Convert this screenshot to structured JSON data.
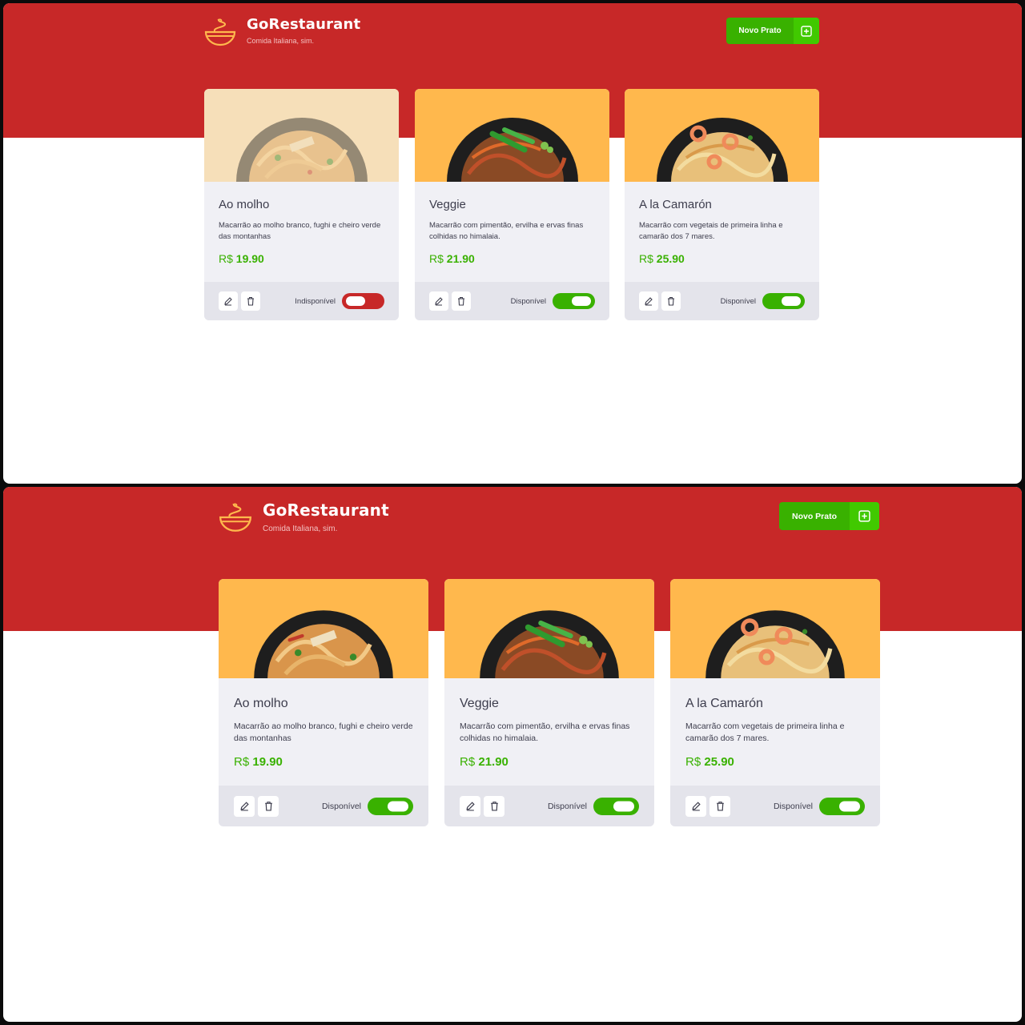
{
  "colors": {
    "hero_red": "#c72828",
    "accent_green": "#39b100",
    "card_image_bg": "#ffb84d",
    "card_bg": "#f0f0f5",
    "footer_bg": "#e4e4eb"
  },
  "screens": [
    {
      "header": {
        "logo_icon": "bowl-icon",
        "title": "GoRestaurant",
        "subtitle": "Comida Italiana, sim.",
        "new_button_label": "Novo Prato",
        "new_button_icon": "plus-square-icon"
      },
      "cards": [
        {
          "name": "Ao molho",
          "description": "Macarrão ao molho branco, fughi e cheiro verde das montanhas",
          "currency": "R$",
          "price": "19.90",
          "availability_label": "Indisponível",
          "available": false,
          "image_icon": "pasta-plate-image"
        },
        {
          "name": "Veggie",
          "description": "Macarrão com pimentão, ervilha e ervas finas colhidas no himalaia.",
          "currency": "R$",
          "price": "21.90",
          "availability_label": "Disponível",
          "available": true,
          "image_icon": "noodles-veggie-image"
        },
        {
          "name": "A la Camarón",
          "description": "Macarrão com vegetais de primeira linha e camarão dos 7 mares.",
          "currency": "R$",
          "price": "25.90",
          "availability_label": "Disponível",
          "available": true,
          "image_icon": "shrimp-pasta-image"
        }
      ]
    },
    {
      "header": {
        "logo_icon": "bowl-icon",
        "title": "GoRestaurant",
        "subtitle": "Comida Italiana, sim.",
        "new_button_label": "Novo Prato",
        "new_button_icon": "plus-square-icon"
      },
      "cards": [
        {
          "name": "Ao molho",
          "description": "Macarrão ao molho branco, fughi e cheiro verde das montanhas",
          "currency": "R$",
          "price": "19.90",
          "availability_label": "Disponível",
          "available": true,
          "image_icon": "pasta-plate-image"
        },
        {
          "name": "Veggie",
          "description": "Macarrão com pimentão, ervilha e ervas finas colhidas no himalaia.",
          "currency": "R$",
          "price": "21.90",
          "availability_label": "Disponível",
          "available": true,
          "image_icon": "noodles-veggie-image"
        },
        {
          "name": "A la Camarón",
          "description": "Macarrão com vegetais de primeira linha e camarão dos 7 mares.",
          "currency": "R$",
          "price": "25.90",
          "availability_label": "Disponível",
          "available": true,
          "image_icon": "shrimp-pasta-image"
        }
      ]
    }
  ]
}
